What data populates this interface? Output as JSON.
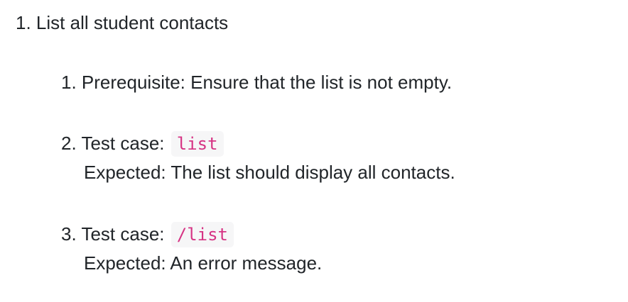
{
  "list": {
    "number": "1.",
    "title": "List all student contacts",
    "items": [
      {
        "number": "1.",
        "text": "Prerequisite: Ensure that the list is not empty."
      },
      {
        "number": "2.",
        "label": "Test case:",
        "command": "list",
        "expected": "Expected: The list should display all contacts."
      },
      {
        "number": "3.",
        "label": "Test case:",
        "command": "/list",
        "expected": "Expected: An error message."
      }
    ]
  }
}
